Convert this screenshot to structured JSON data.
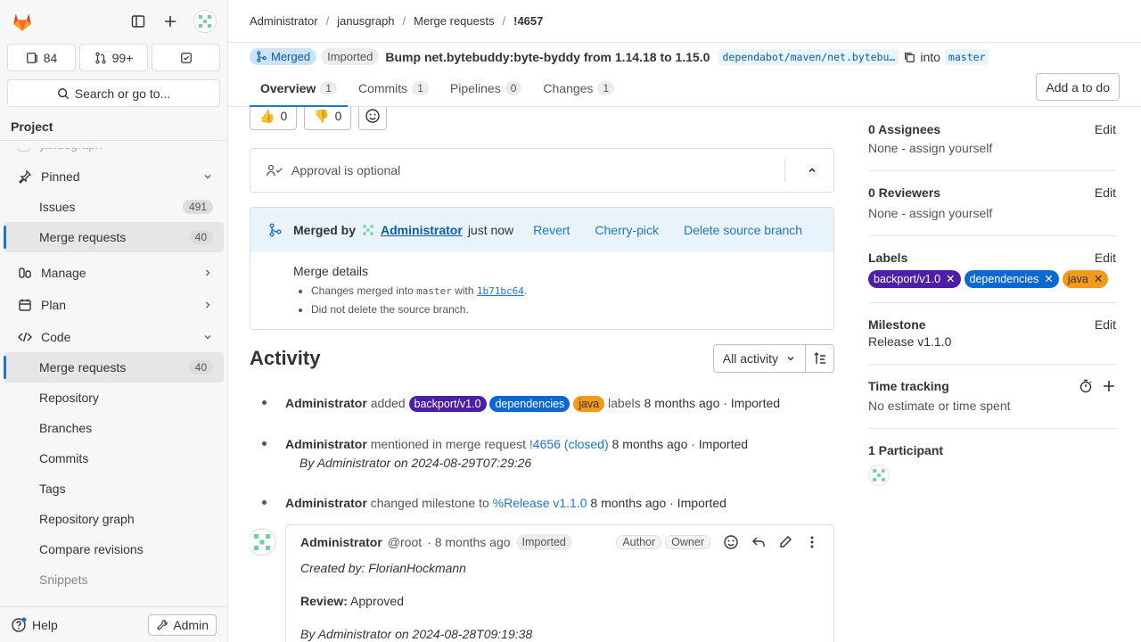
{
  "sidebar": {
    "counts": {
      "issues": "84",
      "mrs": "99+"
    },
    "search_label": "Search or go to...",
    "project_heading": "Project",
    "partial_item": "janusgraph",
    "pinned": "Pinned",
    "issues": "Issues",
    "issues_count": "491",
    "merge_requests": "Merge requests",
    "mr_count": "40",
    "manage": "Manage",
    "plan": "Plan",
    "code": "Code",
    "repository": "Repository",
    "branches": "Branches",
    "commits": "Commits",
    "tags": "Tags",
    "repo_graph": "Repository graph",
    "compare": "Compare revisions",
    "snippets": "Snippets",
    "help": "Help",
    "admin": "Admin"
  },
  "breadcrumb": [
    "Administrator",
    "janusgraph",
    "Merge requests",
    "!4657"
  ],
  "mr": {
    "status": "Merged",
    "imported": "Imported",
    "title": "Bump net.bytebuddy:byte-byddy from 1.14.18 to 1.15.0",
    "source_branch": "dependabot/maven/net.bytebu…",
    "into": "into",
    "target_branch": "master"
  },
  "tabs": [
    {
      "label": "Overview",
      "count": "1"
    },
    {
      "label": "Commits",
      "count": "1"
    },
    {
      "label": "Pipelines",
      "count": "0"
    },
    {
      "label": "Changes",
      "count": "1"
    }
  ],
  "add_todo": "Add a to do",
  "reactions": {
    "thumbs_up": "0",
    "thumbs_down": "0"
  },
  "approval": "Approval is optional",
  "merged": {
    "merged_by": "Merged by",
    "user": "Administrator",
    "when": "just now",
    "revert": "Revert",
    "cherry": "Cherry-pick",
    "delete_branch": "Delete source branch",
    "details_title": "Merge details",
    "detail1_pre": "Changes merged into",
    "detail1_branch": "master",
    "detail1_mid": "with",
    "detail1_sha": "1b71bc64",
    "detail1_end": ".",
    "detail2": "Did not delete the source branch."
  },
  "activity": {
    "title": "Activity",
    "filter": "All activity",
    "events": {
      "e1": {
        "user": "Administrator",
        "action": "added",
        "suffix": "labels",
        "time": "8 months ago · Imported"
      },
      "e2": {
        "user": "Administrator",
        "action": "mentioned in merge request",
        "link": "!4656 (closed)",
        "time": "8 months ago · Imported",
        "sub": "By Administrator on 2024-08-29T07:29:26"
      },
      "e3": {
        "user": "Administrator",
        "action": "changed milestone to",
        "link": "%Release v1.1.0",
        "time": "8 months ago · Imported"
      }
    },
    "note": {
      "user": "Administrator",
      "handle": "@root",
      "time": "· 8 months ago",
      "imported": "Imported",
      "author": "Author",
      "owner": "Owner",
      "line1": "Created by: FlorianHockmann",
      "review_label": "Review:",
      "review_value": "Approved",
      "line3": "By Administrator on 2024-08-28T09:19:38"
    }
  },
  "labels": [
    {
      "name": "backport/v1.0",
      "color": "#4c1fa6"
    },
    {
      "name": "dependencies",
      "color": "#0a68d1"
    },
    {
      "name": "java",
      "color": "#f39a1d"
    }
  ],
  "aside": {
    "assignees": "0 Assignees",
    "assignees_val": "None - assign yourself",
    "reviewers": "0 Reviewers",
    "reviewers_val": "None - assign yourself",
    "labels": "Labels",
    "milestone": "Milestone",
    "milestone_val": "Release v1.1.0",
    "time": "Time tracking",
    "time_val": "No estimate or time spent",
    "participants": "1 Participant",
    "edit": "Edit"
  }
}
